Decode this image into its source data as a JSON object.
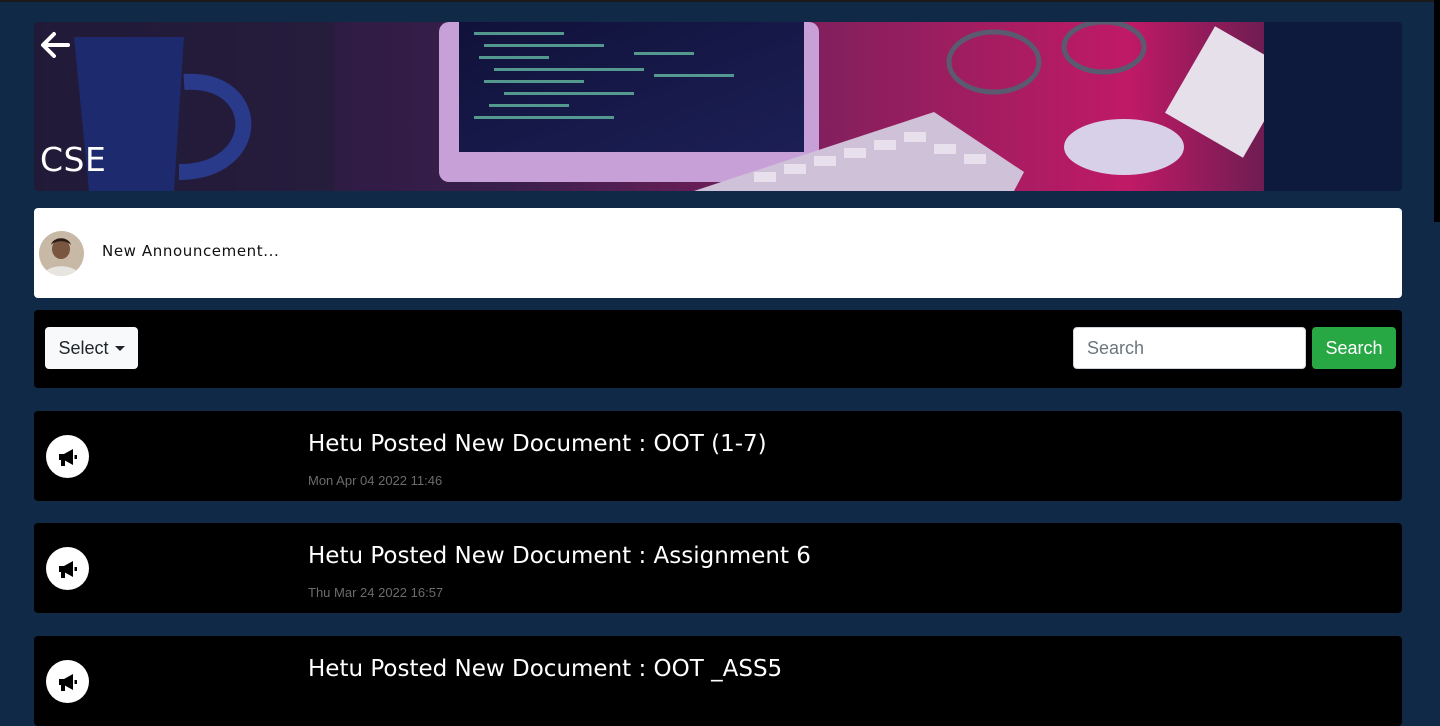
{
  "course": {
    "title": "CSE"
  },
  "announcement": {
    "placeholder": "New Announcement..."
  },
  "filter": {
    "select_label": "Select",
    "search_placeholder": "Search",
    "search_button": "Search"
  },
  "posts": [
    {
      "title": "Hetu Posted New Document : OOT (1-7)",
      "date": "Mon Apr 04 2022 11:46"
    },
    {
      "title": "Hetu Posted New Document : Assignment 6",
      "date": "Thu Mar 24 2022 16:57"
    },
    {
      "title": "Hetu Posted New Document : OOT _ASS5",
      "date": ""
    }
  ],
  "icons": {
    "back": "arrow-left-icon",
    "post": "megaphone-icon"
  },
  "colors": {
    "page_background": "#0f2946",
    "card_background": "#000000",
    "search_button": "#28a745",
    "select_button": "#f8f9fa"
  }
}
